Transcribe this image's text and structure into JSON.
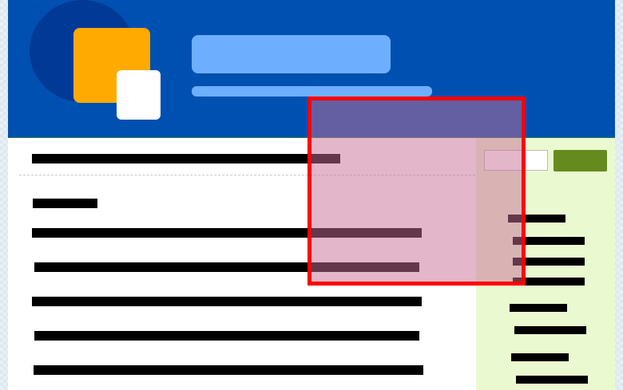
{
  "header": {
    "logo_icon": "logo-icon"
  },
  "sidebar": {
    "search_placeholder": "",
    "search_button_label": ""
  },
  "colors": {
    "header_bg": "#0050b1",
    "title_placeholder": "#6eaeff",
    "logo_orange": "#ffaa00",
    "sidebar_bg": "#ebf9d0",
    "search_button": "#658b1e",
    "highlight_border": "#ff0000"
  }
}
